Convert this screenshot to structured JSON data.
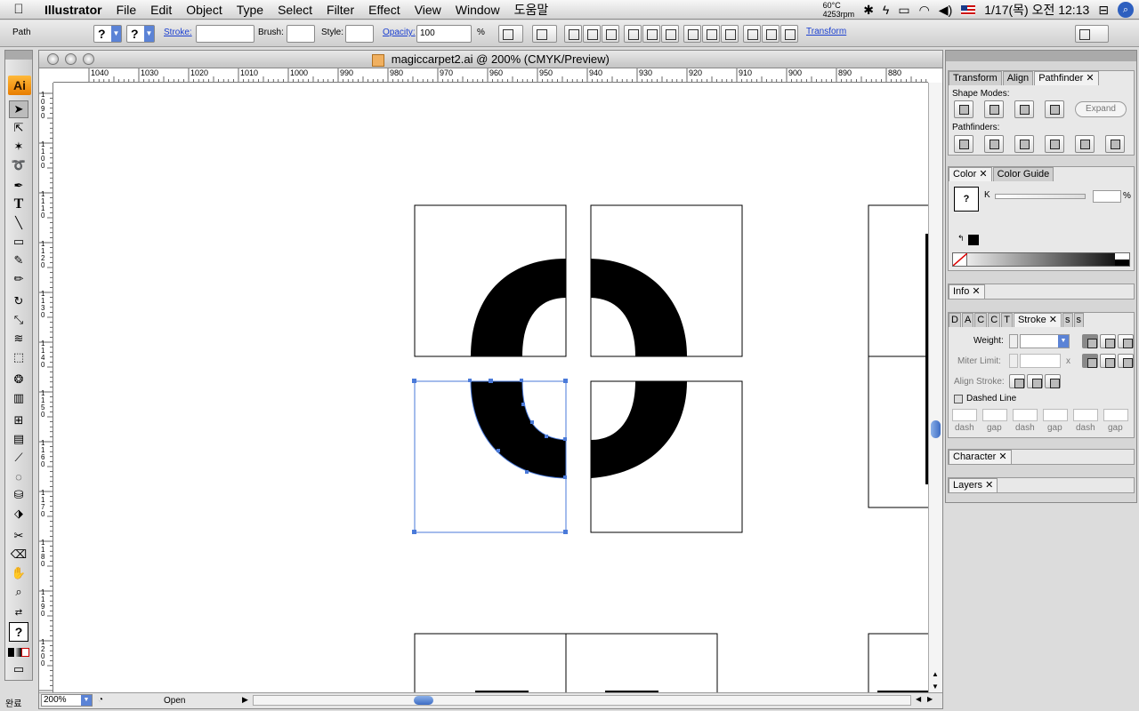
{
  "menubar": {
    "apple_icon": "apple-icon",
    "items": [
      "Illustrator",
      "File",
      "Edit",
      "Object",
      "Type",
      "Select",
      "Filter",
      "Effect",
      "View",
      "Window",
      "도움말"
    ],
    "temperature": "60°C",
    "rpm": "4253rpm",
    "datetime": "1/17(목) 오전 12:13"
  },
  "control": {
    "selection_label": "Path",
    "fill_value": "?",
    "stroke_value": "?",
    "stroke_label": "Stroke:",
    "brush_label": "Brush:",
    "style_label": "Style:",
    "opacity_label": "Opacity:",
    "opacity_value": "100",
    "percent": "%",
    "transform_label": "Transform"
  },
  "document": {
    "title": "magiccarpet2.ai @ 200% (CMYK/Preview)",
    "h_ruler_labels": [
      "1040",
      "1030",
      "1020",
      "1010",
      "1000",
      "990",
      "980",
      "970",
      "960",
      "950",
      "940",
      "930",
      "920",
      "910",
      "900",
      "890",
      "880"
    ],
    "v_ruler_labels": [
      "1090",
      "1100",
      "1110",
      "1120",
      "1130",
      "1140",
      "1150",
      "1160",
      "1170",
      "1180",
      "1190",
      "1200"
    ],
    "zoom": "200%",
    "status": "Open",
    "lower_left": "완료"
  },
  "toolbox": {
    "logo": "Ai",
    "tools": [
      "selection-tool",
      "direct-selection-tool",
      "magic-wand-tool",
      "lasso-tool",
      "pen-tool",
      "type-tool",
      "line-tool",
      "rectangle-tool",
      "paintbrush-tool",
      "pencil-tool",
      "rotate-tool",
      "scale-tool",
      "warp-tool",
      "free-transform-tool",
      "symbol-sprayer-tool",
      "column-graph-tool",
      "mesh-tool",
      "gradient-tool",
      "eyedropper-tool",
      "blend-tool",
      "live-paint-bucket-tool",
      "live-paint-selection-tool",
      "slice-tool",
      "eraser-tool",
      "hand-tool",
      "zoom-tool"
    ],
    "type_glyph": "T"
  },
  "panels": {
    "pathfinder": {
      "tabs": [
        "Transform",
        "Align",
        "Pathfinder"
      ],
      "shape_modes_label": "Shape Modes:",
      "expand_label": "Expand",
      "pathfinders_label": "Pathfinders:"
    },
    "color": {
      "tabs": [
        "Color",
        "Color Guide"
      ],
      "channel_label": "K",
      "percent": "%"
    },
    "info": {
      "tabs": [
        "Info"
      ]
    },
    "stroke": {
      "tabs": [
        "D",
        "A",
        "C",
        "C",
        "T",
        "Stroke",
        "s",
        "s"
      ],
      "weight_label": "Weight:",
      "miter_label": "Miter Limit:",
      "miter_unit": "x",
      "align_label": "Align Stroke:",
      "dashed_label": "Dashed Line",
      "dash_labels": [
        "dash",
        "gap",
        "dash",
        "gap",
        "dash",
        "gap"
      ]
    },
    "character": {
      "tabs": [
        "Character"
      ]
    },
    "layers": {
      "tabs": [
        "Layers"
      ]
    }
  }
}
